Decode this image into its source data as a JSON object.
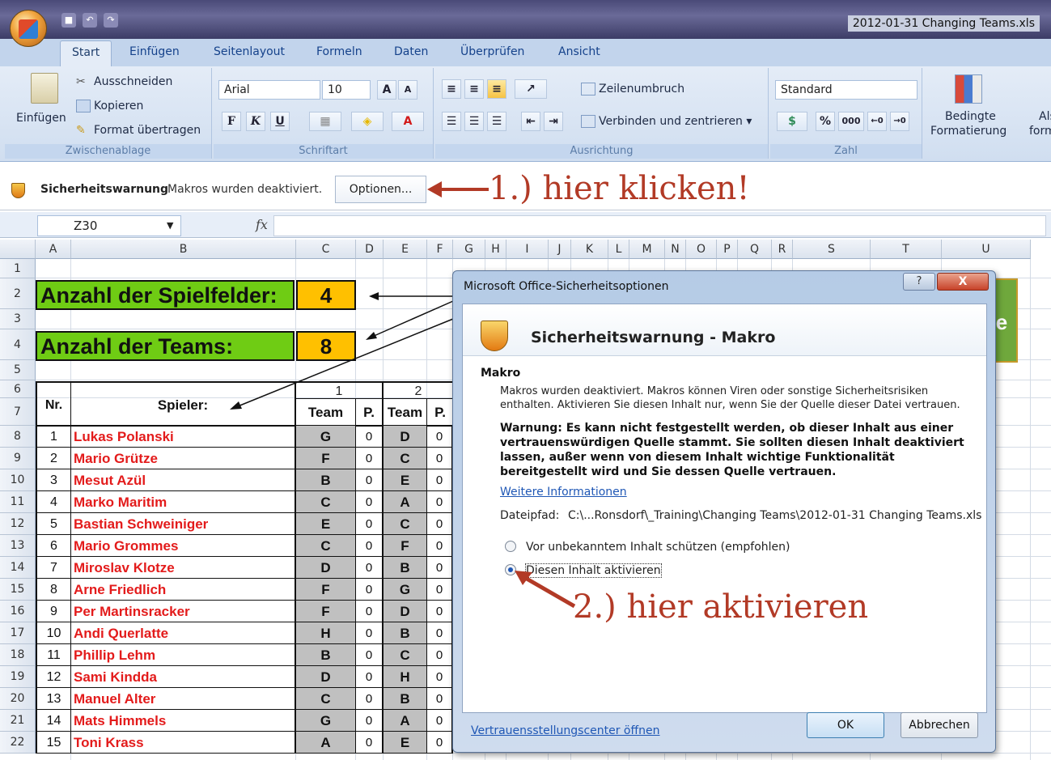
{
  "window": {
    "title": "2012-01-31 Changing Teams.xls"
  },
  "tabs": [
    {
      "label": "Start",
      "active": true
    },
    {
      "label": "Einfügen"
    },
    {
      "label": "Seitenlayout"
    },
    {
      "label": "Formeln"
    },
    {
      "label": "Daten"
    },
    {
      "label": "Überprüfen"
    },
    {
      "label": "Ansicht"
    }
  ],
  "ribbon": {
    "clipboard": {
      "paste": "Einfügen",
      "cut": "Ausschneiden",
      "copy": "Kopieren",
      "format_painter": "Format übertragen",
      "label": "Zwischenablage"
    },
    "font": {
      "name": "Arial",
      "size": "10",
      "bold": "F",
      "italic": "K",
      "underline": "U",
      "label": "Schriftart"
    },
    "alignment": {
      "wrap": "Zeilenumbruch",
      "merge": "Verbinden und zentrieren",
      "label": "Ausrichtung"
    },
    "number": {
      "format": "Standard",
      "percent": "%",
      "thousands": "000",
      "label": "Zahl"
    },
    "styles": {
      "conditional_1": "Bedingte",
      "conditional_2": "Formatierung",
      "more_1": "Als",
      "more_2": "form"
    }
  },
  "security_bar": {
    "title": "Sicherheitswarnung",
    "message": "Makros wurden deaktiviert.",
    "button": "Optionen...",
    "annotation": "1.) hier klicken!"
  },
  "formula_bar": {
    "cell_ref": "Z30",
    "fx": "fx",
    "value": ""
  },
  "columns": [
    "A",
    "B",
    "C",
    "D",
    "E",
    "F",
    "G",
    "H",
    "I",
    "J",
    "K",
    "L",
    "M",
    "N",
    "O",
    "P",
    "Q",
    "R",
    "S",
    "T",
    "U"
  ],
  "rows": [
    "1",
    "2",
    "3",
    "4",
    "5",
    "6",
    "7",
    "8",
    "9",
    "10",
    "11",
    "12",
    "13",
    "14",
    "15",
    "16",
    "17",
    "18",
    "19",
    "20",
    "21",
    "22"
  ],
  "sheet": {
    "fields_label": "Anzahl der Spielfelder:",
    "fields_value": "4",
    "teams_label": "Anzahl der Teams:",
    "teams_value": "8",
    "nr_header": "Nr.",
    "player_header": "Spieler:",
    "round1": "1",
    "round2": "2",
    "team_header": "Team",
    "points_header": "P.",
    "peek_letter": "e",
    "players": [
      {
        "nr": "1",
        "name": "Lukas Polanski",
        "t1": "G",
        "p1": "0",
        "t2": "D",
        "p2": "0"
      },
      {
        "nr": "2",
        "name": "Mario Grütze",
        "t1": "F",
        "p1": "0",
        "t2": "C",
        "p2": "0"
      },
      {
        "nr": "3",
        "name": "Mesut Azül",
        "t1": "B",
        "p1": "0",
        "t2": "E",
        "p2": "0"
      },
      {
        "nr": "4",
        "name": "Marko Maritim",
        "t1": "C",
        "p1": "0",
        "t2": "A",
        "p2": "0"
      },
      {
        "nr": "5",
        "name": "Bastian Schweiniger",
        "t1": "E",
        "p1": "0",
        "t2": "C",
        "p2": "0"
      },
      {
        "nr": "6",
        "name": "Mario Grommes",
        "t1": "C",
        "p1": "0",
        "t2": "F",
        "p2": "0"
      },
      {
        "nr": "7",
        "name": "Miroslav Klotze",
        "t1": "D",
        "p1": "0",
        "t2": "B",
        "p2": "0"
      },
      {
        "nr": "8",
        "name": "Arne Friedlich",
        "t1": "F",
        "p1": "0",
        "t2": "G",
        "p2": "0"
      },
      {
        "nr": "9",
        "name": "Per Martinsracker",
        "t1": "F",
        "p1": "0",
        "t2": "D",
        "p2": "0"
      },
      {
        "nr": "10",
        "name": "Andi Querlatte",
        "t1": "H",
        "p1": "0",
        "t2": "B",
        "p2": "0"
      },
      {
        "nr": "11",
        "name": "Phillip Lehm",
        "t1": "B",
        "p1": "0",
        "t2": "C",
        "p2": "0"
      },
      {
        "nr": "12",
        "name": "Sami Kindda",
        "t1": "D",
        "p1": "0",
        "t2": "H",
        "p2": "0"
      },
      {
        "nr": "13",
        "name": "Manuel Alter",
        "t1": "C",
        "p1": "0",
        "t2": "B",
        "p2": "0"
      },
      {
        "nr": "14",
        "name": "Mats Himmels",
        "t1": "G",
        "p1": "0",
        "t2": "A",
        "p2": "0"
      },
      {
        "nr": "15",
        "name": "Toni Krass",
        "t1": "A",
        "p1": "0",
        "t2": "E",
        "p2": "0"
      }
    ]
  },
  "dialog": {
    "title": "Microsoft Office-Sicherheitsoptionen",
    "help": "?",
    "close": "X",
    "heading": "Sicherheitswarnung - Makro",
    "section": "Makro",
    "info": "Makros wurden deaktiviert. Makros können Viren oder sonstige Sicherheitsrisiken enthalten. Aktivieren Sie diesen Inhalt nur, wenn Sie der Quelle dieser Datei vertrauen.",
    "warning": "Warnung: Es kann nicht festgestellt werden, ob dieser Inhalt aus einer vertrauenswürdigen Quelle stammt. Sie sollten diesen Inhalt deaktiviert lassen, außer wenn von diesem Inhalt wichtige Funktionalität bereitgestellt wird und Sie dessen Quelle vertrauen.",
    "more_info": "Weitere Informationen",
    "path_label": "Dateipfad:",
    "path_value": "C:\\...Ronsdorf\\_Training\\Changing Teams\\2012-01-31 Changing Teams.xls",
    "option_protect": "Vor unbekanntem Inhalt schützen (empfohlen)",
    "option_enable": "Diesen Inhalt aktivieren",
    "ok": "OK",
    "cancel": "Abbrechen",
    "trust_center": "Vertrauensstellungscenter öffnen",
    "annotation": "2.) hier aktivieren"
  }
}
